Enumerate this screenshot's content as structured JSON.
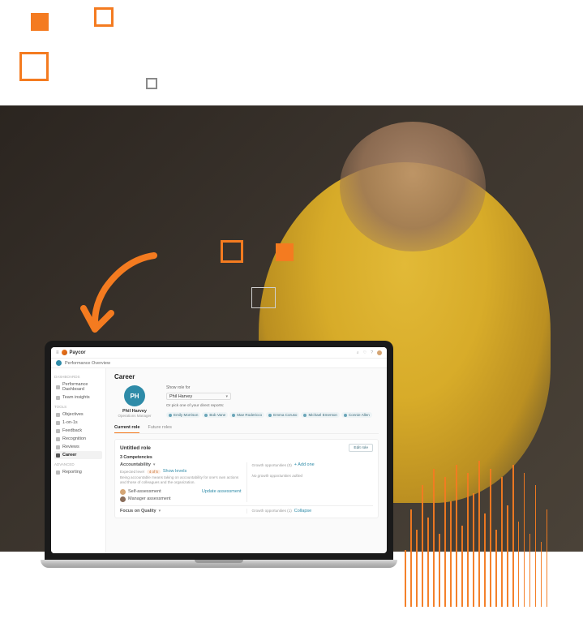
{
  "colors": {
    "accent": "#f47b20",
    "teal": "#2e8ba8"
  },
  "decor": {
    "shapes": [
      "filled-square",
      "outlined-square"
    ]
  },
  "app": {
    "brand": "Paycor",
    "header_icons": [
      "search-icon",
      "bell-icon",
      "help-icon",
      "avatar"
    ],
    "breadcrumb": "Performance Overview",
    "sidebar": {
      "groups": [
        {
          "label": "DASHBOARDS",
          "items": [
            {
              "label": "Performance Dashboard"
            },
            {
              "label": "Team insights"
            }
          ]
        },
        {
          "label": "TOOLS",
          "items": [
            {
              "label": "Objectives"
            },
            {
              "label": "1-on-1s"
            },
            {
              "label": "Feedback"
            },
            {
              "label": "Recognition"
            },
            {
              "label": "Reviews"
            },
            {
              "label": "Career",
              "active": true
            }
          ]
        },
        {
          "label": "ADVANCED",
          "items": [
            {
              "label": "Reporting"
            }
          ]
        }
      ]
    },
    "page": {
      "title": "Career",
      "profile": {
        "initials": "PH",
        "name": "Phil Harvey",
        "role_title": "Operations Manager"
      },
      "role_for": {
        "label": "Show role for",
        "value": "Phil Harvey",
        "hint": "Or pick one of your direct reports:",
        "chips": [
          "Emily Morrison",
          "Bob Vane",
          "Mae Rodericco",
          "Emma Coruso",
          "Michael Emerson",
          "Connie Allen"
        ]
      },
      "tabs": [
        {
          "label": "Current role",
          "active": true
        },
        {
          "label": "Future roles"
        }
      ],
      "card": {
        "title": "Untitled role",
        "edit_label": "Edit role",
        "section_label": "3 Competencies",
        "left": {
          "competency": "Accountability",
          "level_label": "Expected level",
          "level_value": "4 of 5",
          "link": "Show levels",
          "desc": "Being accountable means taking on accountability for one's own actions and those of colleagues and the organization.",
          "assess1": "Self-assessment",
          "assess1_action": "Update assessment",
          "assess2": "Manager assessment",
          "footer_competency": "Focus on Quality"
        },
        "right": {
          "growth_label": "Growth opportunities (0)",
          "add_label": "+ Add one",
          "empty": "No growth opportunities added",
          "footer_growth": "Growth opportunities (1)",
          "footer_link": "Collapse"
        }
      }
    }
  }
}
